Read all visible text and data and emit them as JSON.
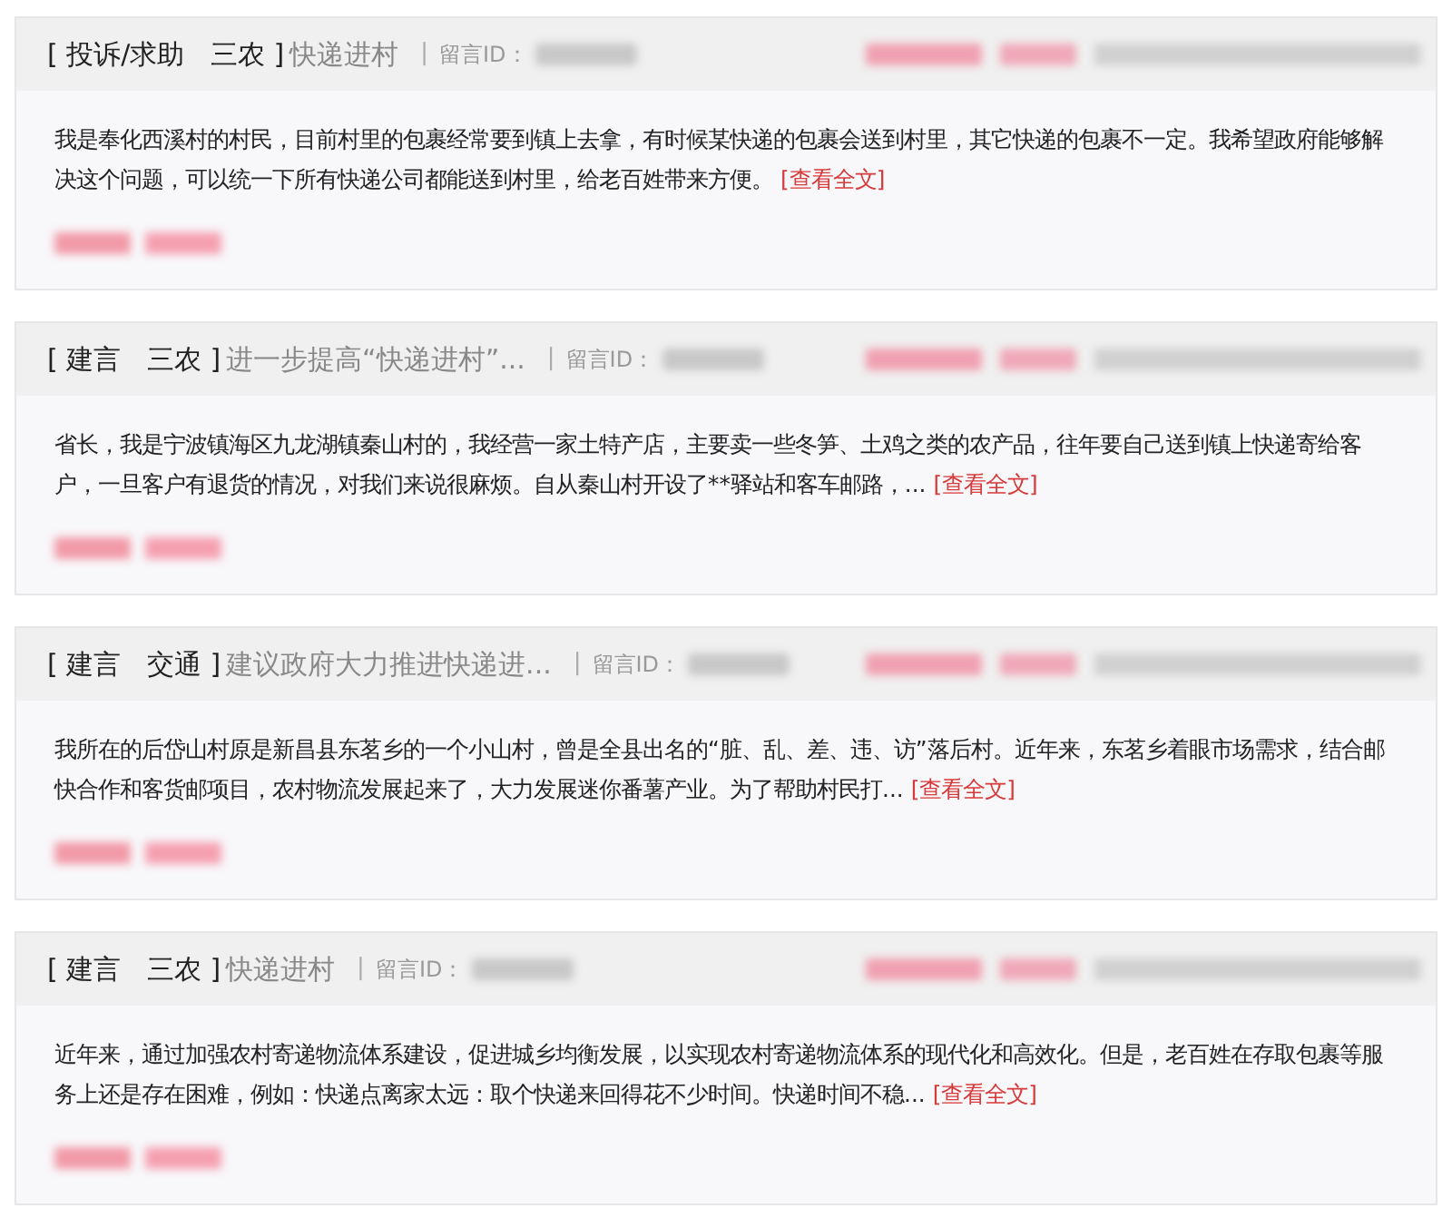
{
  "posts": [
    {
      "category": "[ 投诉/求助   三农 ]",
      "title": "快递进村",
      "separator": "|",
      "id_label": "留言ID：",
      "body": "我是奉化西溪村的村民，目前村里的包裹经常要到镇上去拿，有时候某快递的包裹会送到村里，其它快递的包裹不一定。我希望政府能够解决这个问题，可以统一下所有快递公司都能送到村里，给老百姓带来方便。",
      "link": "[查看全文]"
    },
    {
      "category": "[ 建言   三农 ]",
      "title": "进一步提高“快递进村”...",
      "separator": "|",
      "id_label": "留言ID：",
      "body": "省长，我是宁波镇海区九龙湖镇秦山村的，我经营一家土特产店，主要卖一些冬笋、土鸡之类的农产品，往年要自己送到镇上快递寄给客户，一旦客户有退货的情况，对我们来说很麻烦。自从秦山村开设了**驿站和客车邮路，...",
      "link": "[查看全文]"
    },
    {
      "category": "[ 建言   交通 ]",
      "title": "建议政府大力推进快递进...",
      "separator": "|",
      "id_label": "留言ID：",
      "body": "我所在的后岱山村原是新昌县东茗乡的一个小山村，曾是全县出名的“脏、乱、差、违、访”落后村。近年来，东茗乡着眼市场需求，结合邮快合作和客货邮项目，农村物流发展起来了，大力发展迷你番薯产业。为了帮助村民打...",
      "link": "[查看全文]"
    },
    {
      "category": "[ 建言   三农 ]",
      "title": "快递进村",
      "separator": "|",
      "id_label": "留言ID：",
      "body": "近年来，通过加强农村寄递物流体系建设，促进城乡均衡发展，以实现农村寄递物流体系的现代化和高效化。但是，老百姓在存取包裹等服务上还是存在困难，例如：快递点离家太远：取个快递来回得花不少时间。快递时间不稳...",
      "link": "[查看全文]"
    }
  ]
}
